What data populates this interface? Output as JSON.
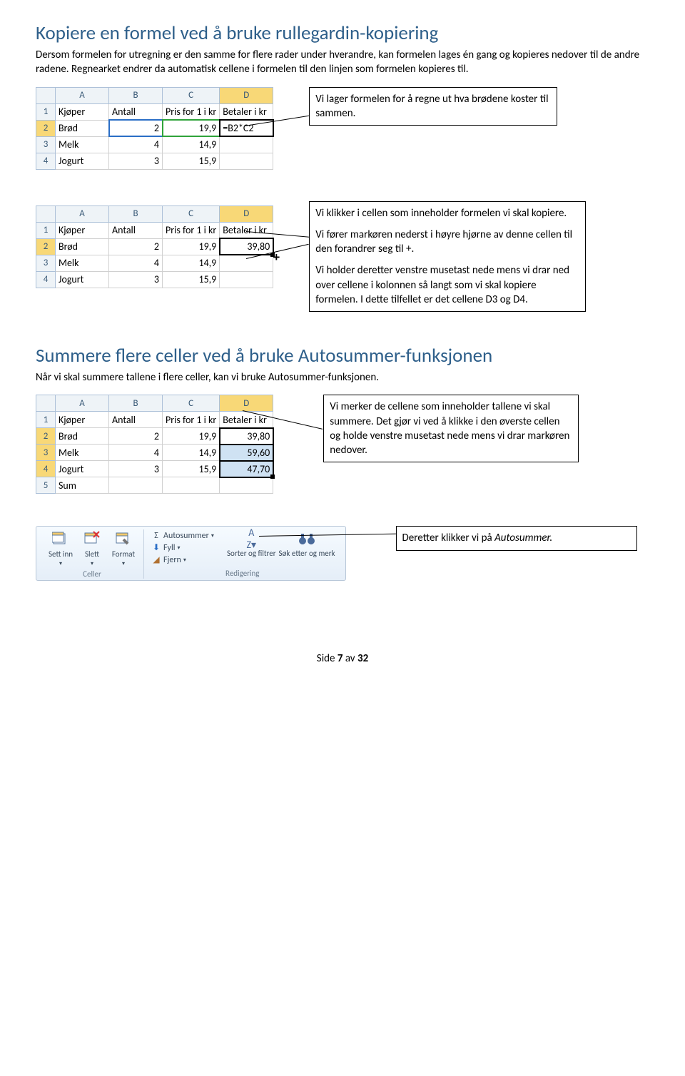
{
  "section1": {
    "heading": "Kopiere en formel ved å bruke rullegardin-kopiering",
    "p1": "Dersom formelen for utregning er den samme for flere rader under hverandre, kan formelen lages én gang og kopieres nedover til de andre radene. Regnearket endrer da automatisk cellene i formelen til den linjen som formelen kopieres til.",
    "callout1": "Vi lager formelen for å regne ut hva brødene koster til sammen.",
    "callout2a": "Vi klikker i cellen som inneholder formelen vi skal kopiere.",
    "callout2b": "Vi fører markøren nederst i høyre hjørne av denne cellen til den forandrer seg til +.",
    "callout2c": "Vi holder deretter venstre musetast nede mens vi drar ned over cellene i kolonnen så langt som vi skal kopiere formelen. I dette tilfellet er det cellene D3 og D4."
  },
  "grid_cols": {
    "c1": "A",
    "c2": "B",
    "c3": "C",
    "c4": "D"
  },
  "grid_rowN": {
    "r1": "1",
    "r2": "2",
    "r3": "3",
    "r4": "4",
    "r5": "5"
  },
  "hdr": {
    "a": "Kjøper",
    "b": "Antall",
    "c": "Pris for 1 i kr",
    "d": "Betaler i kr"
  },
  "rows": {
    "r2": {
      "a": "Brød",
      "b": "2",
      "c": "19,9"
    },
    "r3": {
      "a": "Melk",
      "b": "4",
      "c": "14,9"
    },
    "r4": {
      "a": "Jogurt",
      "b": "3",
      "c": "15,9"
    },
    "r5": {
      "a": "Sum"
    }
  },
  "d2_formula": "=B2*C2",
  "d2_value": "39,80",
  "d3_value": "59,60",
  "d4_value": "47,70",
  "section2": {
    "heading": "Summere flere celler ved å bruke Autosummer-funksjonen",
    "p1": "Når vi skal summere tallene i flere celler, kan vi bruke Autosummer-funksjonen.",
    "callout1": "Vi merker de cellene som inneholder tallene vi skal summere. Det gjør vi ved å klikke i den øverste cellen og holde venstre musetast nede mens vi drar markøren nedover.",
    "callout2_pre": "Deretter klikker vi på ",
    "callout2_em": "Autosummer."
  },
  "ribbon": {
    "insert": "Sett inn",
    "delete": "Slett",
    "format": "Format",
    "cells_caption": "Celler",
    "autosum": "Autosummer",
    "fill": "Fyll",
    "clear": "Fjern",
    "sort": "Sorter og filtrer",
    "find": "Søk etter og merk",
    "editing_caption": "Redigering"
  },
  "footer": {
    "text_pre": "Side ",
    "page": "7",
    "text_mid": " av ",
    "total": "32"
  }
}
